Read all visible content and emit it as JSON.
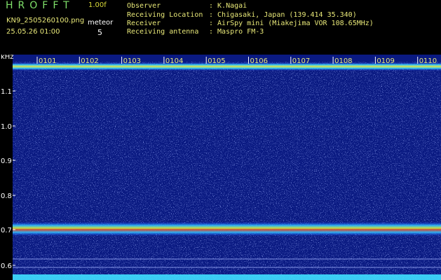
{
  "header": {
    "app_name": "HROFFT",
    "version": "1.00f",
    "filename": "KN9_2505260100.png",
    "meteor_label": "meteor",
    "meteor_count": "5",
    "datetime": "25.05.26 01:00",
    "info_rows": [
      {
        "label": "Observer",
        "value": ": K.Nagai"
      },
      {
        "label": "Receiving Location",
        "value": ": Chigasaki, Japan (139.414 35.340)"
      },
      {
        "label": "Receiver",
        "value": ": AirSpy mini (Miakejima VOR 108.65MHz)"
      },
      {
        "label": "Receiving antenna",
        "value": ": Maspro FM-3"
      }
    ]
  },
  "spectrogram": {
    "unit_label": "kHz",
    "y_ticks": [
      "1.1",
      "1.0",
      "0.9",
      "0.8",
      "0.7",
      "0.6"
    ],
    "time_ticks": [
      "0101",
      "0102",
      "0103",
      "0104",
      "0105",
      "0106",
      "0107",
      "0108",
      "0109",
      "0110"
    ],
    "colors": {
      "background": "#0a1a82",
      "tick_text": "#e8e878",
      "axis_text": "#ffffff",
      "noise_floor": "#3fe0ff"
    }
  }
}
